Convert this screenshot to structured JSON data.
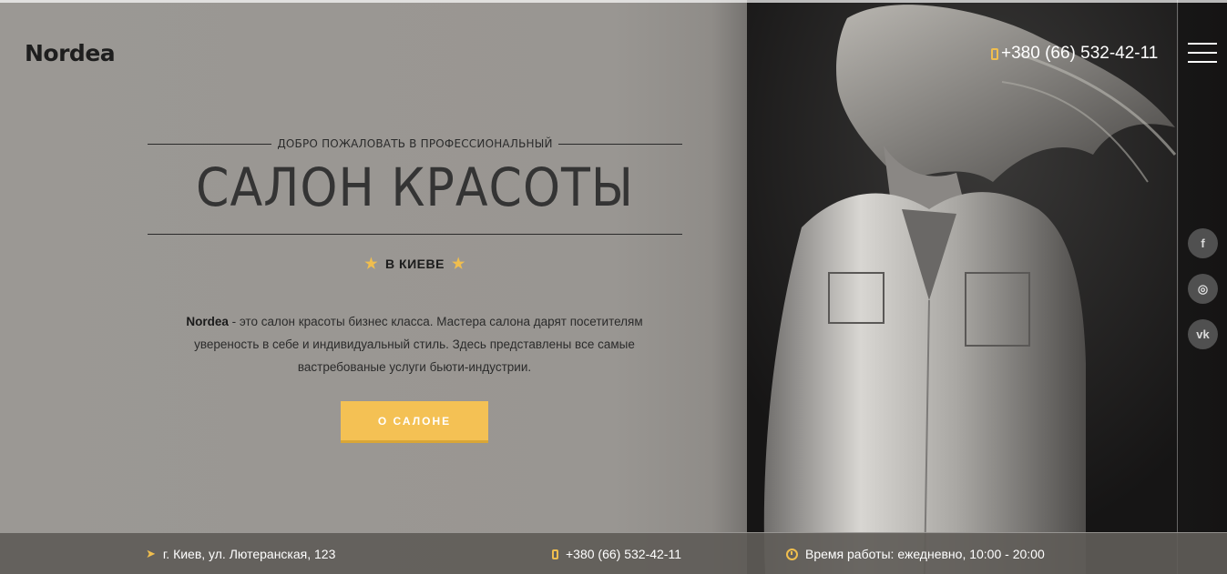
{
  "brand": {
    "logo": "Nordea"
  },
  "header": {
    "phone": "+380 (66) 532-42-11"
  },
  "hero": {
    "welcome": "ДОБРО ПОЖАЛОВАТЬ В ПРОФЕССИОНАЛЬНЫЙ",
    "title": "САЛОН КРАСОТЫ",
    "city": "В КИЕВЕ",
    "desc_brand": "Nordea",
    "desc_line1": " - это салон красоты бизнес класса. Мастера салона дарят посетителям",
    "desc_line2": "увереность в себе и индивидуальный стиль. Здесь представлены все самые",
    "desc_line3": "вастребованые услуги бьюти-индустрии.",
    "cta": "О САЛОНЕ"
  },
  "social": {
    "facebook": "f",
    "instagram": "◎",
    "vk": "vk"
  },
  "footer": {
    "address": "г. Киев, ул. Лютеранская, 123",
    "phone": "+380 (66) 532-42-11",
    "hours": "Время работы: ежедневно, 10:00 - 20:00"
  },
  "colors": {
    "accent": "#f4c154",
    "bg": "#9a9793",
    "dark": "#1d1c1b"
  }
}
